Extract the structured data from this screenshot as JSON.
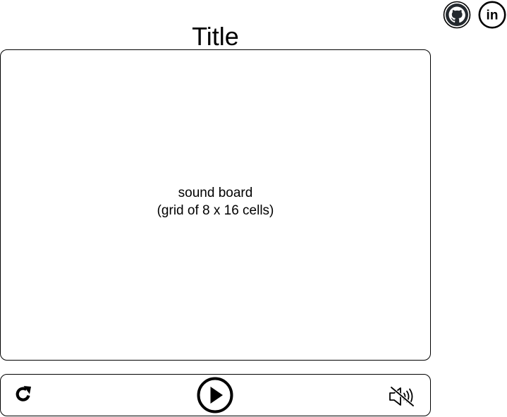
{
  "header": {
    "title": "Title"
  },
  "social": {
    "github_icon": "github-icon",
    "linkedin_icon": "linkedin-icon",
    "linkedin_text": "in"
  },
  "board": {
    "line1": "sound board",
    "line2": "(grid of 8 x 16 cells)"
  },
  "controls": {
    "reset_icon": "reset-icon",
    "play_icon": "play-icon",
    "mute_icon": "mute-icon"
  },
  "colors": {
    "github_fill": "#24292e",
    "stroke": "#000000"
  }
}
